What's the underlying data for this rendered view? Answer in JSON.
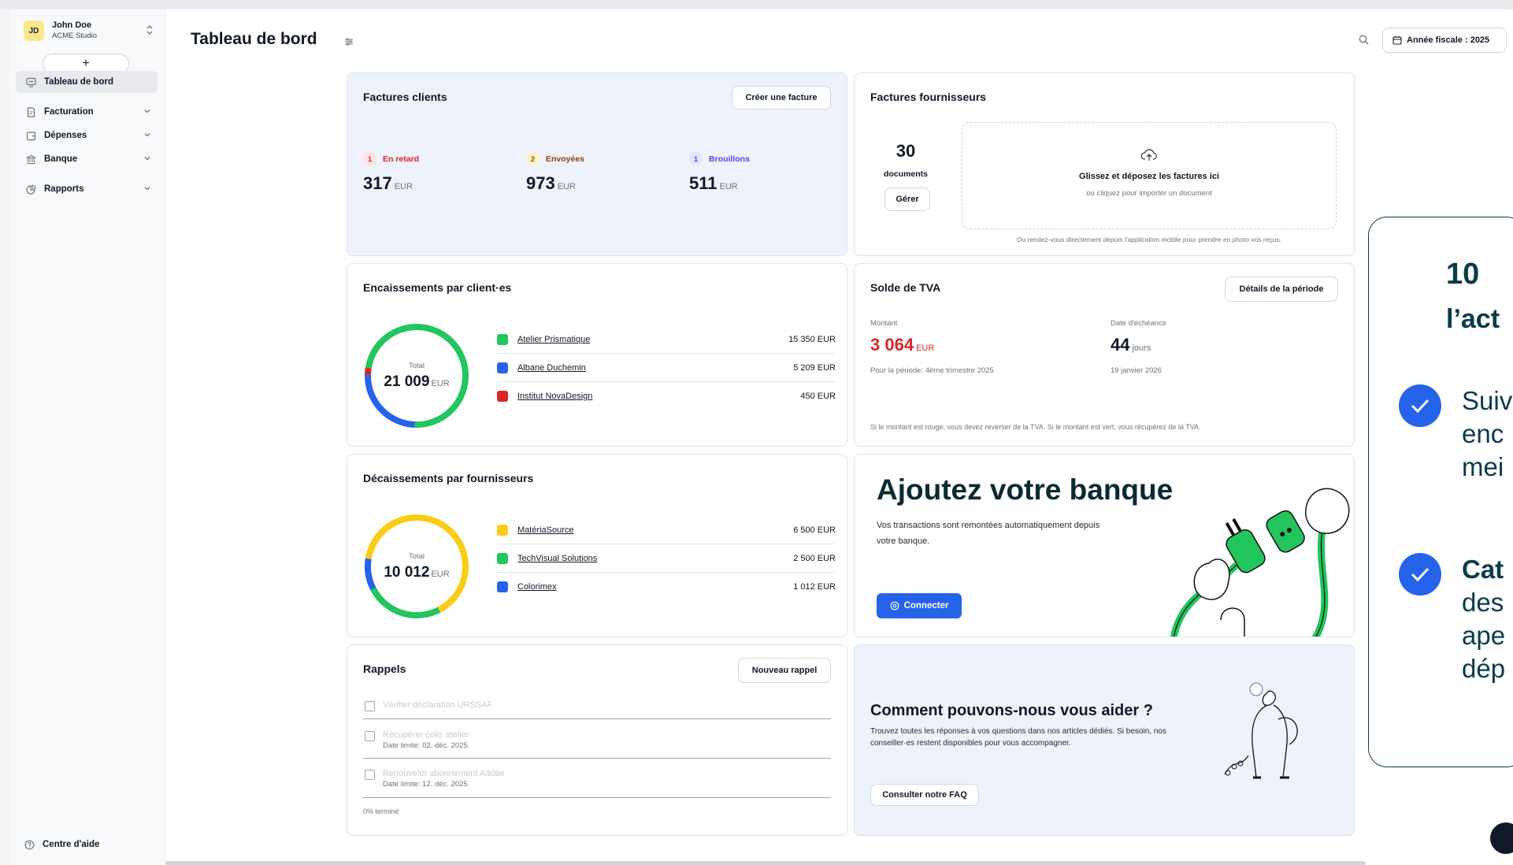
{
  "user": {
    "initials": "JD",
    "name": "John Doe",
    "org": "ACME Studio"
  },
  "sidebar": {
    "add_label": "+",
    "items": [
      {
        "label": "Tableau de bord",
        "icon": "dashboard-icon"
      },
      {
        "label": "Facturation",
        "icon": "invoice-icon"
      },
      {
        "label": "Dépenses",
        "icon": "expenses-icon"
      },
      {
        "label": "Banque",
        "icon": "bank-icon"
      },
      {
        "label": "Rapports",
        "icon": "reports-icon"
      }
    ],
    "help_label": "Centre d'aide"
  },
  "header": {
    "title": "Tableau de bord",
    "fiscal_year": "Année fiscale : 2025"
  },
  "client_invoices": {
    "title": "Factures clients",
    "create_button": "Créer une facture",
    "stats": [
      {
        "count": "1",
        "label": "En retard",
        "value": "317",
        "unit": "EUR",
        "color": "#dc2626",
        "pill_bg": "#fde2e2"
      },
      {
        "count": "2",
        "label": "Envoyées",
        "value": "973",
        "unit": "EUR",
        "color": "#92400e",
        "pill_bg": "#fef3c7"
      },
      {
        "count": "1",
        "label": "Brouillons",
        "value": "511",
        "unit": "EUR",
        "color": "#4f46e5",
        "pill_bg": "#e0e7ff"
      }
    ]
  },
  "supplier_invoices": {
    "title": "Factures fournisseurs",
    "count": "30",
    "count_label": "documents",
    "manage_button": "Gérer",
    "drop_title": "Glissez et déposez les factures ici",
    "drop_sub": "ou cliquez pour importer un document",
    "footnote": "Ou rendez-vous directement depuis l'application mobile pour prendre en photo vos reçus."
  },
  "receipts": {
    "title": "Encaissements par client·es",
    "total_label": "Total",
    "total": "21 009",
    "unit": "EUR",
    "items": [
      {
        "name": "Atelier Prismatique",
        "value": "15 350 EUR",
        "amount": 15350,
        "color": "#22c55e"
      },
      {
        "name": "Albane Duchemin",
        "value": "5 209 EUR",
        "amount": 5209,
        "color": "#2563eb"
      },
      {
        "name": "Institut NovaDesign",
        "value": "450 EUR",
        "amount": 450,
        "color": "#dc2626"
      }
    ]
  },
  "vat": {
    "title": "Solde de TVA",
    "details_button": "Détails de la période",
    "amount_label": "Montant",
    "amount": "3 064",
    "amount_unit": "EUR",
    "period": "Pour la période: 4ème trimestre 2025",
    "due_label": "Date d'échéance",
    "due_days": "44",
    "due_unit": "jours",
    "due_date": "19 janvier 2026",
    "note": "Si le montant est rouge, vous devez reverser de la TVA. Si le montant est vert, vous récupérez de la TVA."
  },
  "payments": {
    "title": "Décaissements par fournisseurs",
    "total_label": "Total",
    "total": "10 012",
    "unit": "EUR",
    "items": [
      {
        "name": "MatériaSource",
        "value": "6 500 EUR",
        "amount": 6500,
        "color": "#facc15"
      },
      {
        "name": "TechVisual Solutions",
        "value": "2 500 EUR",
        "amount": 2500,
        "color": "#22c55e"
      },
      {
        "name": "Colorimex",
        "value": "1 012 EUR",
        "amount": 1012,
        "color": "#2563eb"
      }
    ]
  },
  "bank": {
    "title": "Ajoutez votre banque",
    "desc": "Vos transactions sont remontées automatiquement depuis votre banque.",
    "connect_button": "Connecter"
  },
  "reminders": {
    "title": "Rappels",
    "new_button": "Nouveau rappel",
    "items": [
      {
        "text": "Vérifier déclaration URSSAF",
        "date": ""
      },
      {
        "text": "Récupérer colis atelier",
        "date": "Date limite: 02. déc. 2025"
      },
      {
        "text": "Renouveler abonnement Adobe",
        "date": "Date limite: 12. déc. 2025"
      }
    ],
    "progress": "0% terminé"
  },
  "help_card": {
    "title": "Comment pouvons-nous vous aider ?",
    "desc": "Trouvez toutes les réponses à vos questions dans nos articles dédiés. Si besoin, nos conseiller·es restent disponibles pour vous accompagner.",
    "faq_button": "Consulter notre FAQ"
  },
  "overlay": {
    "title_line1": "10",
    "title_line2": "l’act",
    "items": [
      {
        "lines": [
          "Suiv",
          "enc",
          "mei"
        ]
      },
      {
        "lines": [
          "Cat",
          "des",
          "ape",
          "dép"
        ]
      }
    ]
  }
}
